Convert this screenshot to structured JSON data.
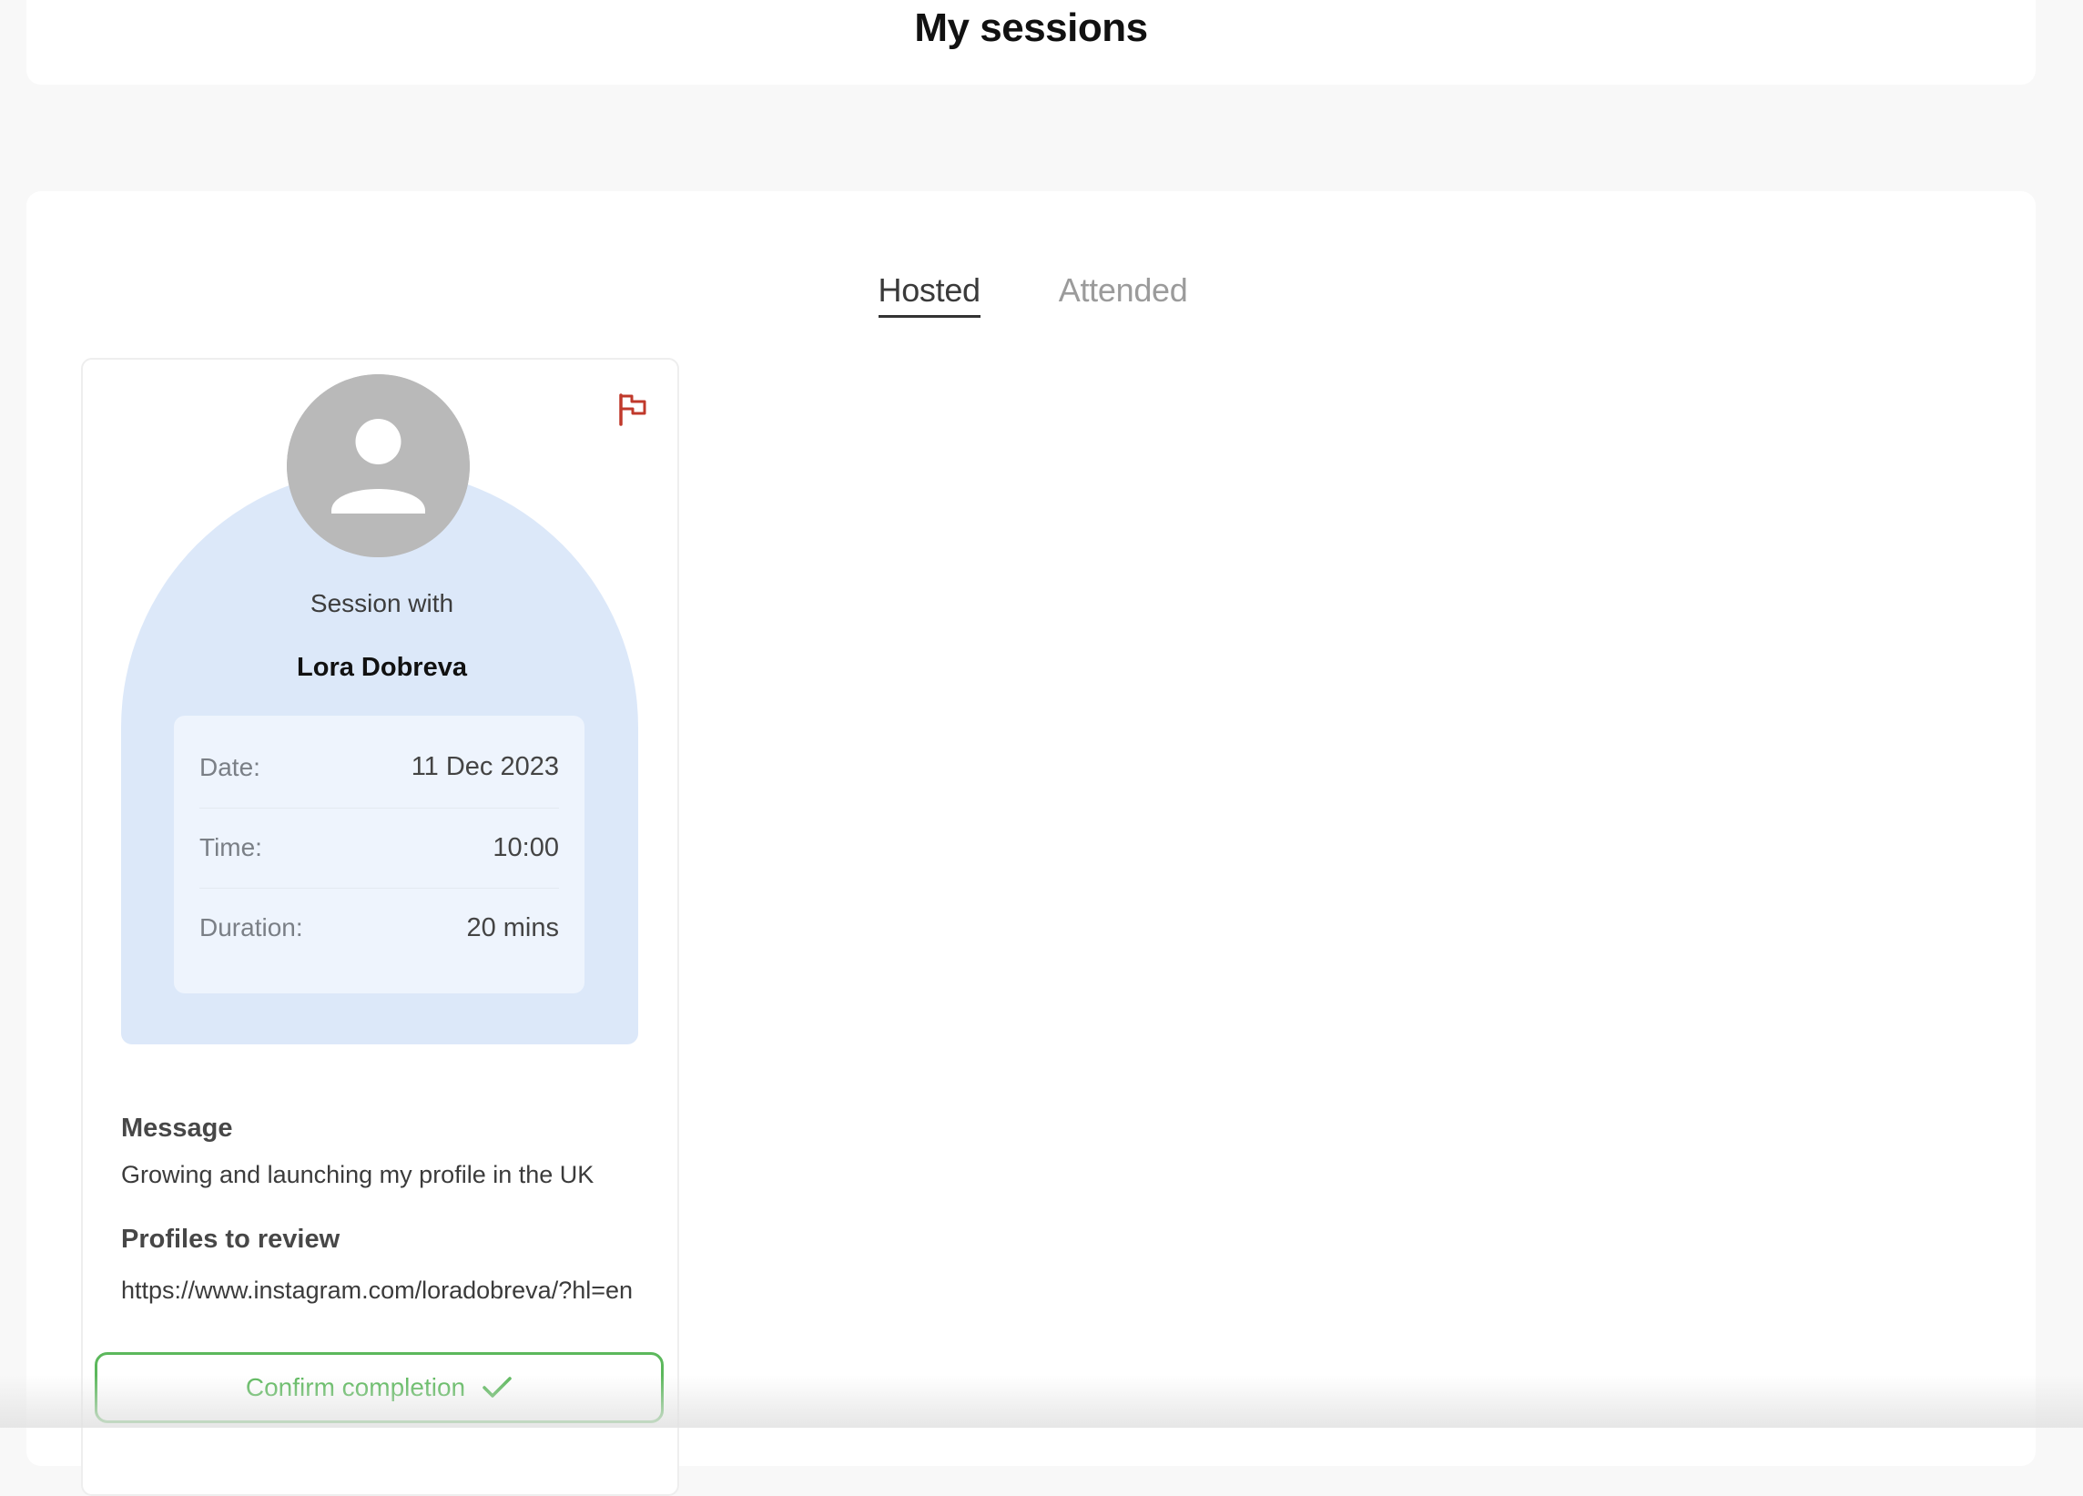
{
  "header": {
    "title": "My sessions"
  },
  "tabs": [
    {
      "label": "Hosted",
      "active": true
    },
    {
      "label": "Attended",
      "active": false
    }
  ],
  "session": {
    "session_with_label": "Session with",
    "name": "Lora Dobreva",
    "details": [
      {
        "label": "Date:",
        "value": "11 Dec 2023"
      },
      {
        "label": "Time:",
        "value": "10:00"
      },
      {
        "label": "Duration:",
        "value": "20 mins"
      }
    ],
    "message_title": "Message",
    "message_text": "Growing and launching my profile in the UK",
    "profiles_title": "Profiles to review",
    "profiles_text": "https://www.instagram.com/loradobreva/?hl=en",
    "confirm_label": "Confirm completion",
    "icons": {
      "flag": "flag-icon",
      "avatar": "user-avatar-icon",
      "check": "check-icon"
    }
  },
  "colors": {
    "accent_green": "#5cb85c",
    "flag_red": "#c0392b",
    "arch_blue": "#dce8f9",
    "details_blue": "#eef4fd"
  }
}
